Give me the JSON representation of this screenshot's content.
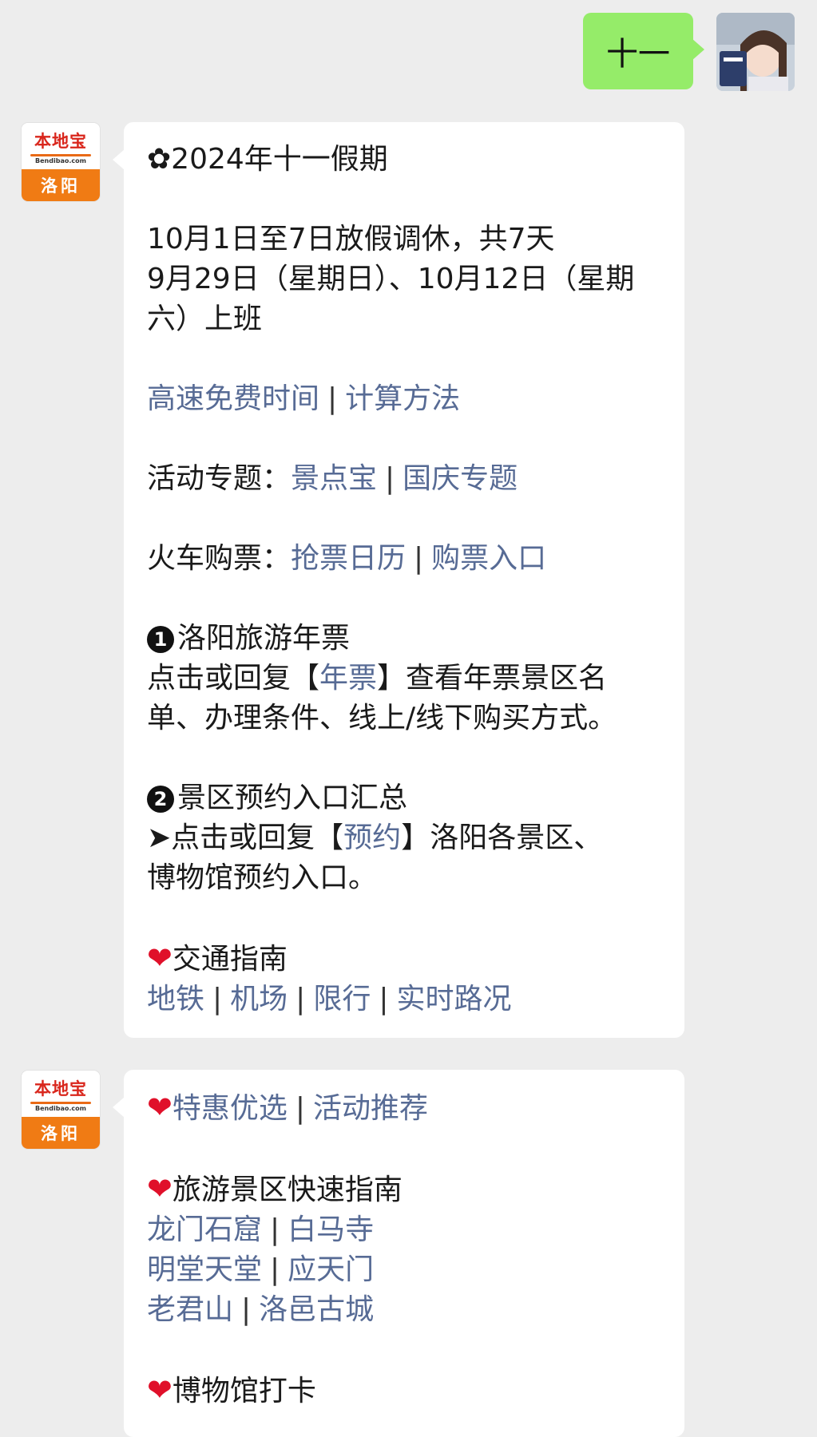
{
  "user_message": {
    "text": "十一"
  },
  "account": {
    "brand": "本地宝",
    "domain": "Bendibao.com",
    "city": "洛阳"
  },
  "message1": {
    "title": "✿2024年十一假期",
    "holiday_line": "10月1日至7日放假调休，共7天",
    "workday_line1": "9月29日（星期日）、10月12日（星期",
    "workday_line2": "六）上班",
    "highway": {
      "link1": "高速免费时间",
      "sep": "|",
      "link2": "计算方法"
    },
    "activity": {
      "label": "活动专题：",
      "link1": "景点宝",
      "sep": "|",
      "link2": "国庆专题"
    },
    "train": {
      "label": "火车购票：",
      "link1": "抢票日历",
      "sep": "|",
      "link2": "购票入口"
    },
    "section1": {
      "num": "1",
      "title": "洛阳旅游年票",
      "line1_pre": "点击或回复【",
      "line1_link": "年票",
      "line1_post": "】查看年票景区名",
      "line2": "单、办理条件、线上/线下购买方式。"
    },
    "section2": {
      "num": "2",
      "title": "景区预约入口汇总",
      "line1_pre": "➤点击或回复【",
      "line1_link": "预约",
      "line1_post": "】洛阳各景区、",
      "line2": "博物馆预约入口。"
    },
    "traffic": {
      "heart": "❤",
      "title": "交通指南",
      "links": [
        "地铁",
        "机场",
        "限行",
        "实时路况"
      ],
      "sep": "|"
    }
  },
  "message2": {
    "heart": "❤",
    "deals": {
      "link1": "特惠优选",
      "sep": "|",
      "link2": "活动推荐"
    },
    "scenic_title": "旅游景区快速指南",
    "scenic_rows": [
      {
        "a": "龙门石窟",
        "b": "白马寺"
      },
      {
        "a": "明堂天堂",
        "b": "应天门"
      },
      {
        "a": "老君山",
        "b": "洛邑古城"
      }
    ],
    "sep": "|",
    "museum_title": "博物馆打卡"
  }
}
